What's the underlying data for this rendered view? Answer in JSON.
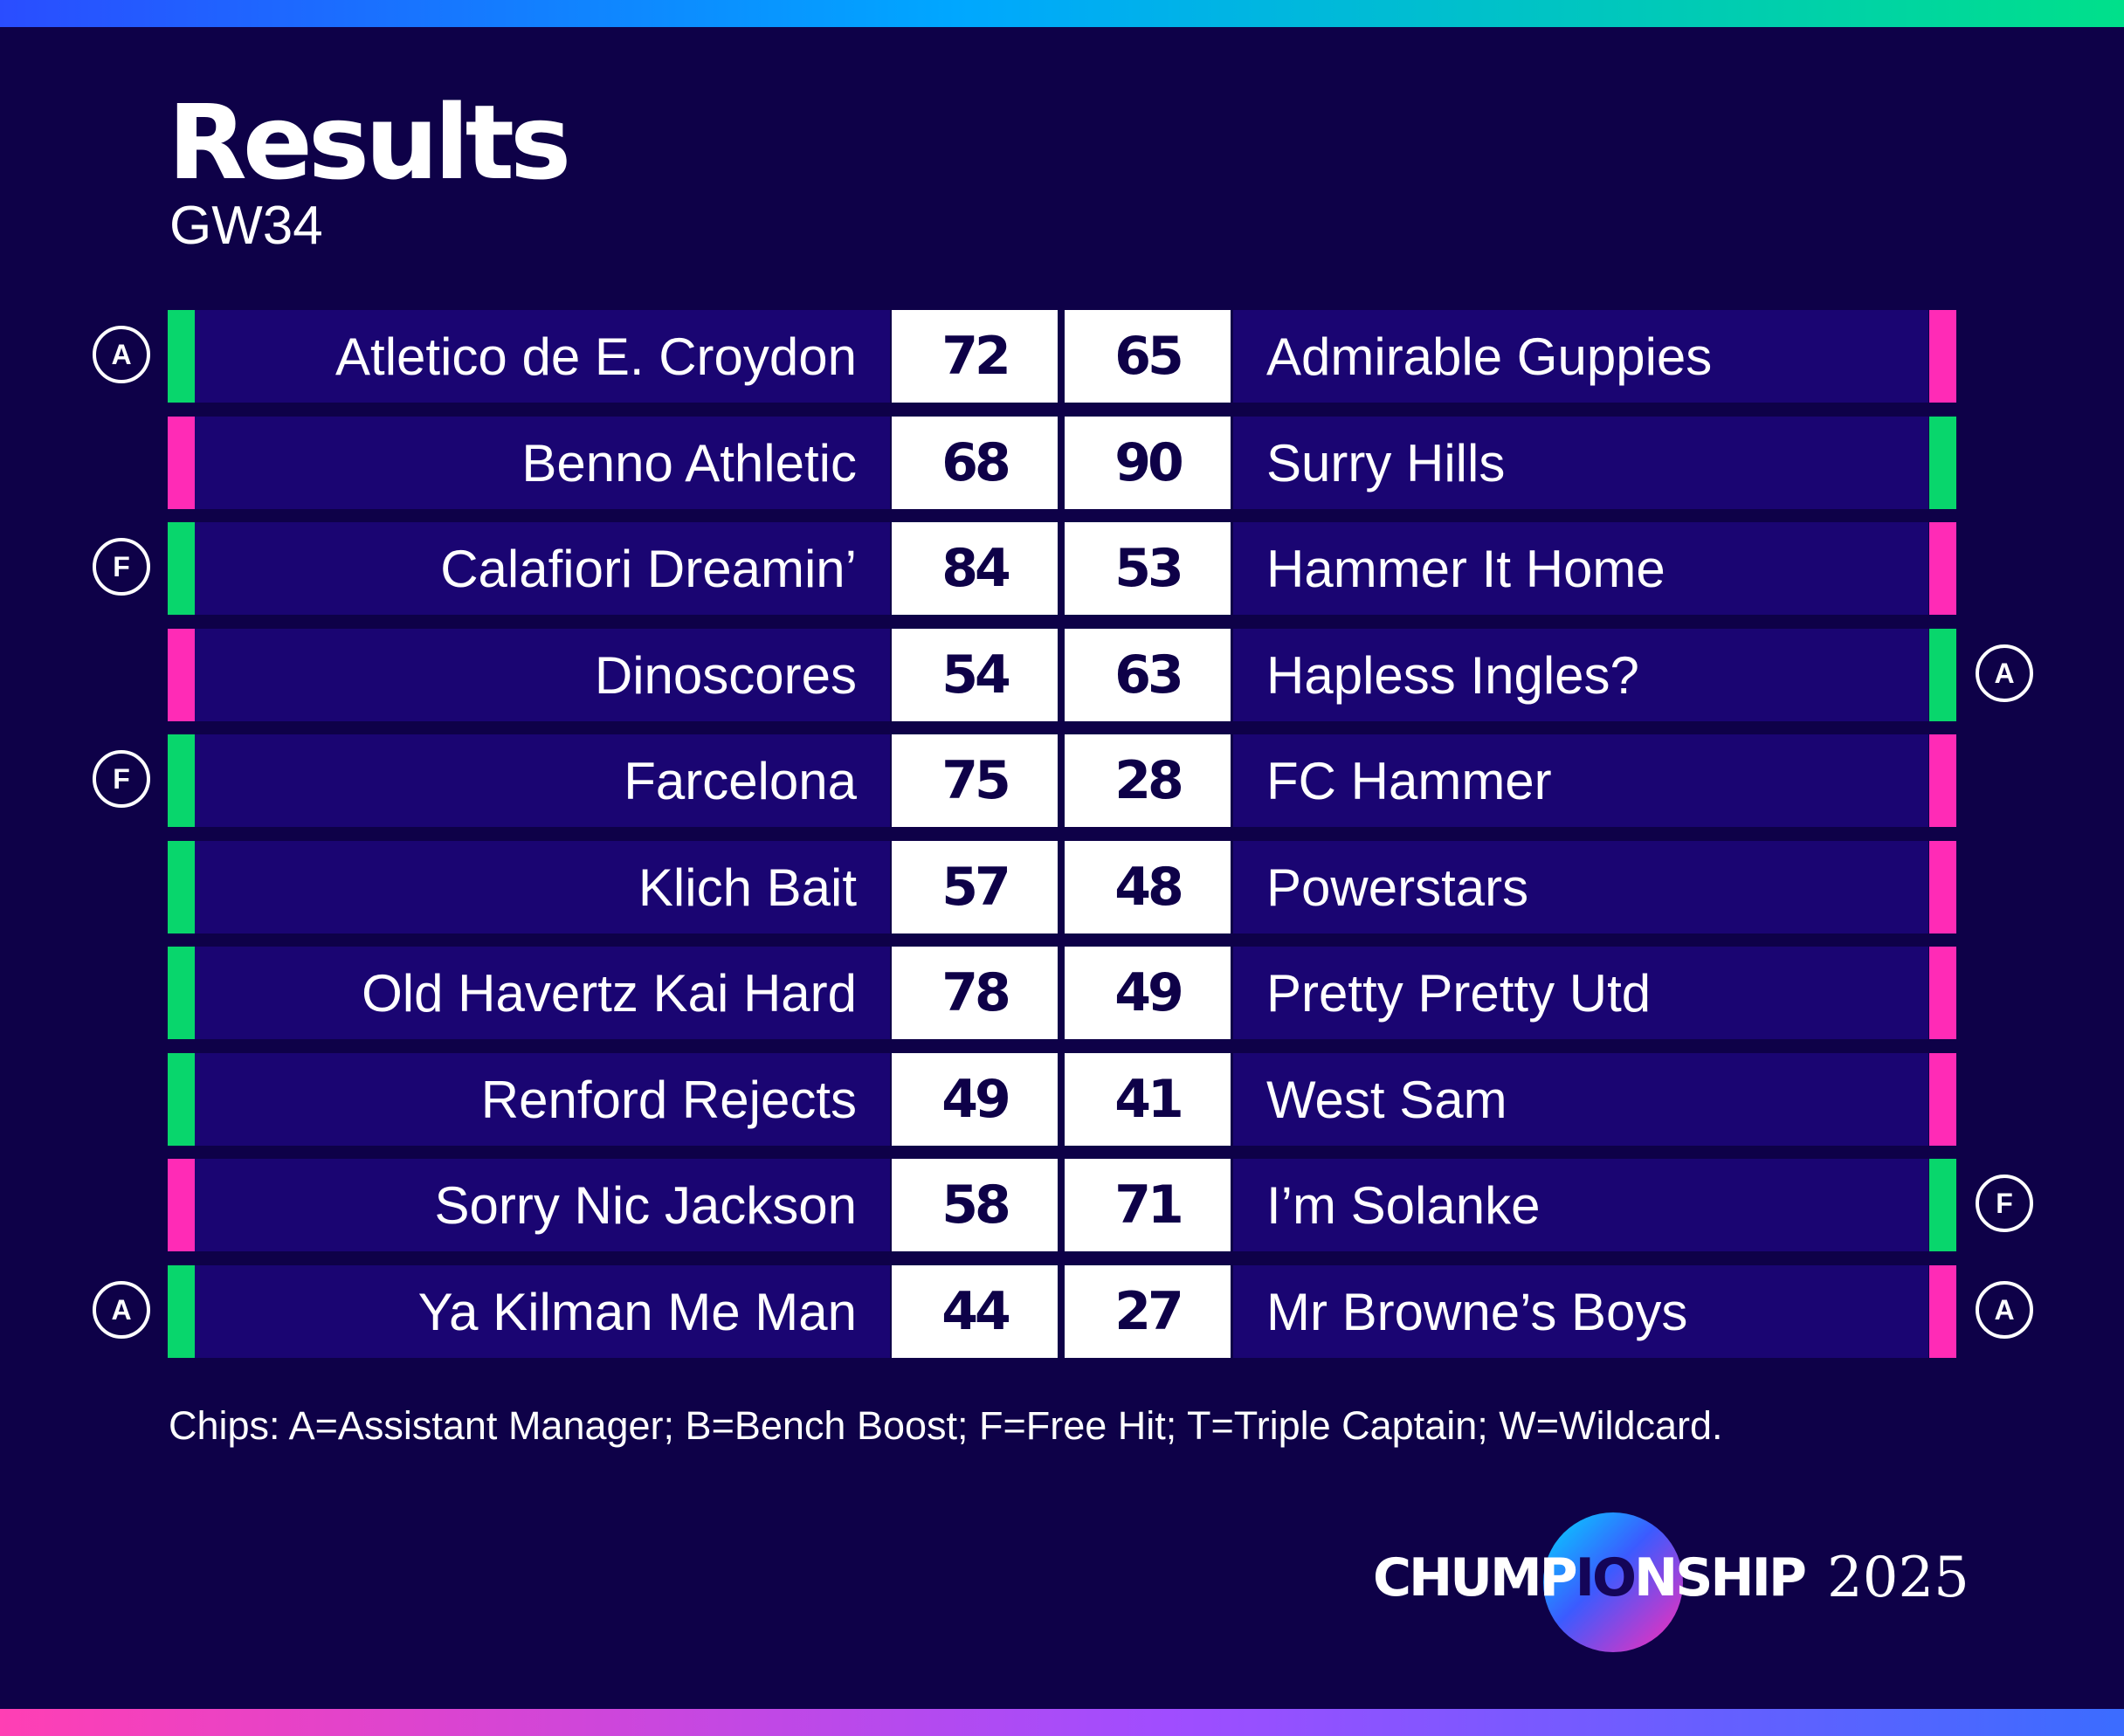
{
  "header": {
    "title": "Results",
    "subtitle": "GW34"
  },
  "colors": {
    "background": "#0e0148",
    "row_background": "#1a0572",
    "win": "#08d66c",
    "loss": "#ff2bb6",
    "score_box": "#ffffff"
  },
  "results": [
    {
      "home": {
        "name": "Atletico de E. Croydon",
        "score": "72",
        "chip": "A",
        "outcome": "win"
      },
      "away": {
        "name": "Admirable Guppies",
        "score": "65",
        "chip": "",
        "outcome": "loss"
      }
    },
    {
      "home": {
        "name": "Benno Athletic",
        "score": "68",
        "chip": "",
        "outcome": "loss"
      },
      "away": {
        "name": "Surry Hills",
        "score": "90",
        "chip": "",
        "outcome": "win"
      }
    },
    {
      "home": {
        "name": "Calafiori Dreamin’",
        "score": "84",
        "chip": "F",
        "outcome": "win"
      },
      "away": {
        "name": "Hammer It Home",
        "score": "53",
        "chip": "",
        "outcome": "loss"
      }
    },
    {
      "home": {
        "name": "Dinoscores",
        "score": "54",
        "chip": "",
        "outcome": "loss"
      },
      "away": {
        "name": "Hapless Ingles?",
        "score": "63",
        "chip": "A",
        "outcome": "win"
      }
    },
    {
      "home": {
        "name": "Farcelona",
        "score": "75",
        "chip": "F",
        "outcome": "win"
      },
      "away": {
        "name": "FC Hammer",
        "score": "28",
        "chip": "",
        "outcome": "loss"
      }
    },
    {
      "home": {
        "name": "Klich Bait",
        "score": "57",
        "chip": "",
        "outcome": "win"
      },
      "away": {
        "name": "Powerstars",
        "score": "48",
        "chip": "",
        "outcome": "loss"
      }
    },
    {
      "home": {
        "name": "Old Havertz Kai Hard",
        "score": "78",
        "chip": "",
        "outcome": "win"
      },
      "away": {
        "name": "Pretty Pretty Utd",
        "score": "49",
        "chip": "",
        "outcome": "loss"
      }
    },
    {
      "home": {
        "name": "Renford Rejects",
        "score": "49",
        "chip": "",
        "outcome": "win"
      },
      "away": {
        "name": "West Sam",
        "score": "41",
        "chip": "",
        "outcome": "loss"
      }
    },
    {
      "home": {
        "name": "Sorry Nic Jackson",
        "score": "58",
        "chip": "",
        "outcome": "loss"
      },
      "away": {
        "name": "I’m Solanke",
        "score": "71",
        "chip": "F",
        "outcome": "win"
      }
    },
    {
      "home": {
        "name": "Ya Kilman Me Man",
        "score": "44",
        "chip": "A",
        "outcome": "win"
      },
      "away": {
        "name": "Mr Browne’s Boys",
        "score": "27",
        "chip": "A",
        "outcome": "loss"
      }
    }
  ],
  "footnote": "Chips: A=Assistant Manager; B=Bench Boost; F=Free Hit; T=Triple Captain; W=Wildcard.",
  "logo": {
    "part1": "CHUMP",
    "part2": "IO",
    "part3": "NSHIP",
    "year": "2025"
  }
}
